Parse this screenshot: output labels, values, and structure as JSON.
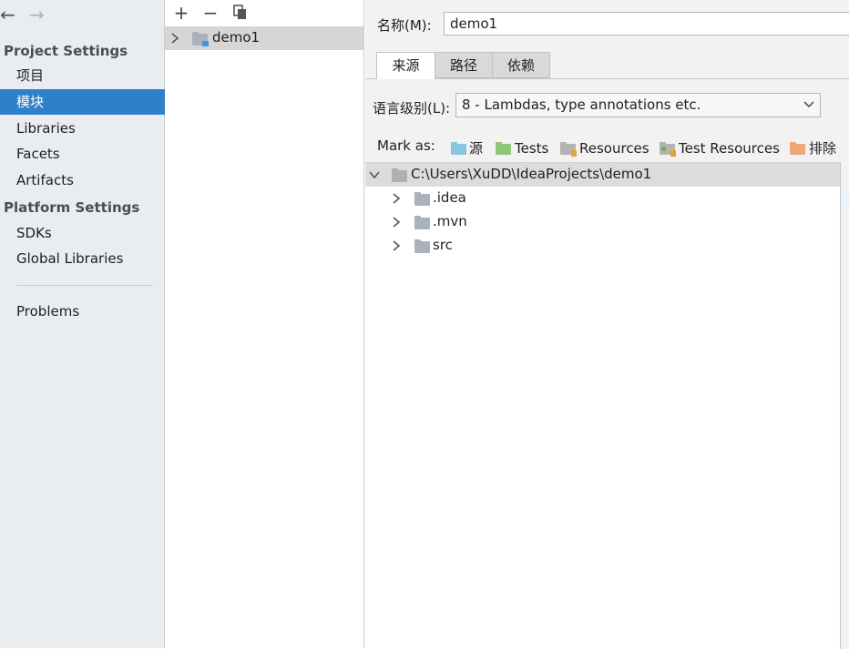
{
  "nav": {
    "back_icon": "arrow-left-icon",
    "forward_icon": "arrow-right-icon"
  },
  "sidebar": {
    "project_settings_header": "Project Settings",
    "project_items": [
      "项目",
      "模块",
      "Libraries",
      "Facets",
      "Artifacts"
    ],
    "selected_index": 1,
    "platform_settings_header": "Platform Settings",
    "platform_items": [
      "SDKs",
      "Global Libraries"
    ],
    "problems": "Problems"
  },
  "modules": {
    "toolbar": {
      "add_icon": "plus-icon",
      "remove_icon": "minus-icon",
      "copy_icon": "copy-icon"
    },
    "items": [
      {
        "name": "demo1",
        "selected": true
      }
    ]
  },
  "detail": {
    "name_label": "名称(M):",
    "name_mnemonic": "M",
    "name_value": "demo1",
    "tabs": [
      "来源",
      "路径",
      "依赖"
    ],
    "active_tab": 0,
    "language_level_label": "语言级别(L):",
    "language_level_value": "8 - Lambdas, type annotations etc.",
    "mark_as_label": "Mark as:",
    "mark_as": [
      {
        "label": "源",
        "color": "#89c4e1"
      },
      {
        "label": "Tests",
        "color": "#8fc77a"
      },
      {
        "label": "Resources",
        "color": "#b3b3b3"
      },
      {
        "label": "Test Resources",
        "color": "#b3b3b3"
      },
      {
        "label": "排除",
        "color": "#f0a67b"
      }
    ],
    "tree": {
      "root": "C:\\Users\\XuDD\\IdeaProjects\\demo1",
      "children": [
        ".idea",
        ".mvn",
        "src"
      ]
    }
  },
  "colors": {
    "selection": "#2f80c9",
    "folder": "#a9b2bb"
  }
}
